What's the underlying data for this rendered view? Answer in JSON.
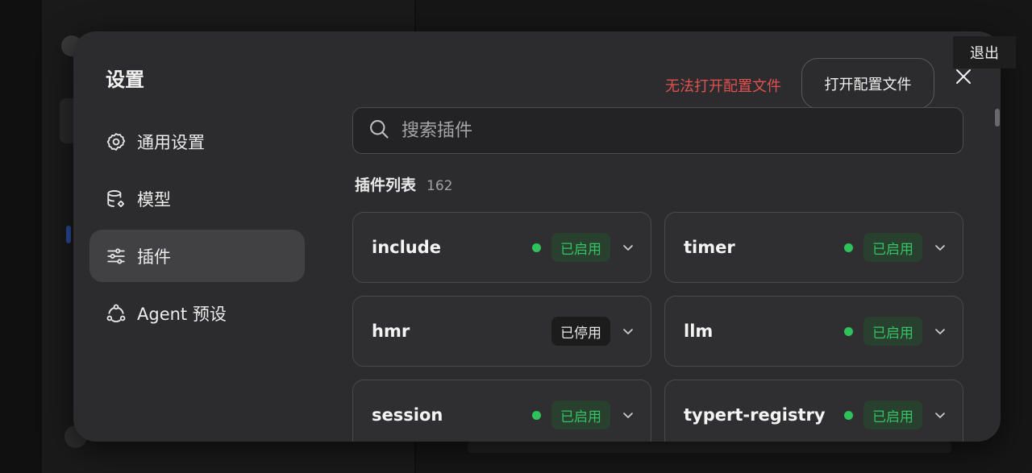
{
  "dialog": {
    "title": "设置",
    "error_text": "无法打开配置文件",
    "open_config_label": "打开配置文件",
    "exit_tooltip": "退出"
  },
  "nav": {
    "items": [
      {
        "label": "通用设置",
        "icon": "gear-icon",
        "active": false
      },
      {
        "label": "模型",
        "icon": "database-gear-icon",
        "active": false
      },
      {
        "label": "插件",
        "icon": "sliders-icon",
        "active": true
      },
      {
        "label": "Agent 预设",
        "icon": "agent-nodes-icon",
        "active": false
      }
    ]
  },
  "search": {
    "placeholder": "搜索插件",
    "value": ""
  },
  "plugin_list": {
    "title": "插件列表",
    "count": "162",
    "plugins": [
      {
        "name": "include",
        "status": "已启用",
        "enabled": true
      },
      {
        "name": "timer",
        "status": "已启用",
        "enabled": true
      },
      {
        "name": "hmr",
        "status": "已停用",
        "enabled": false
      },
      {
        "name": "llm",
        "status": "已启用",
        "enabled": true
      },
      {
        "name": "session",
        "status": "已启用",
        "enabled": true
      },
      {
        "name": "typert-registry",
        "status": "已启用",
        "enabled": true
      }
    ]
  },
  "colors": {
    "enabled_green": "#35c264",
    "error_red": "#e0524f",
    "dialog_bg": "#2c2c2e"
  }
}
